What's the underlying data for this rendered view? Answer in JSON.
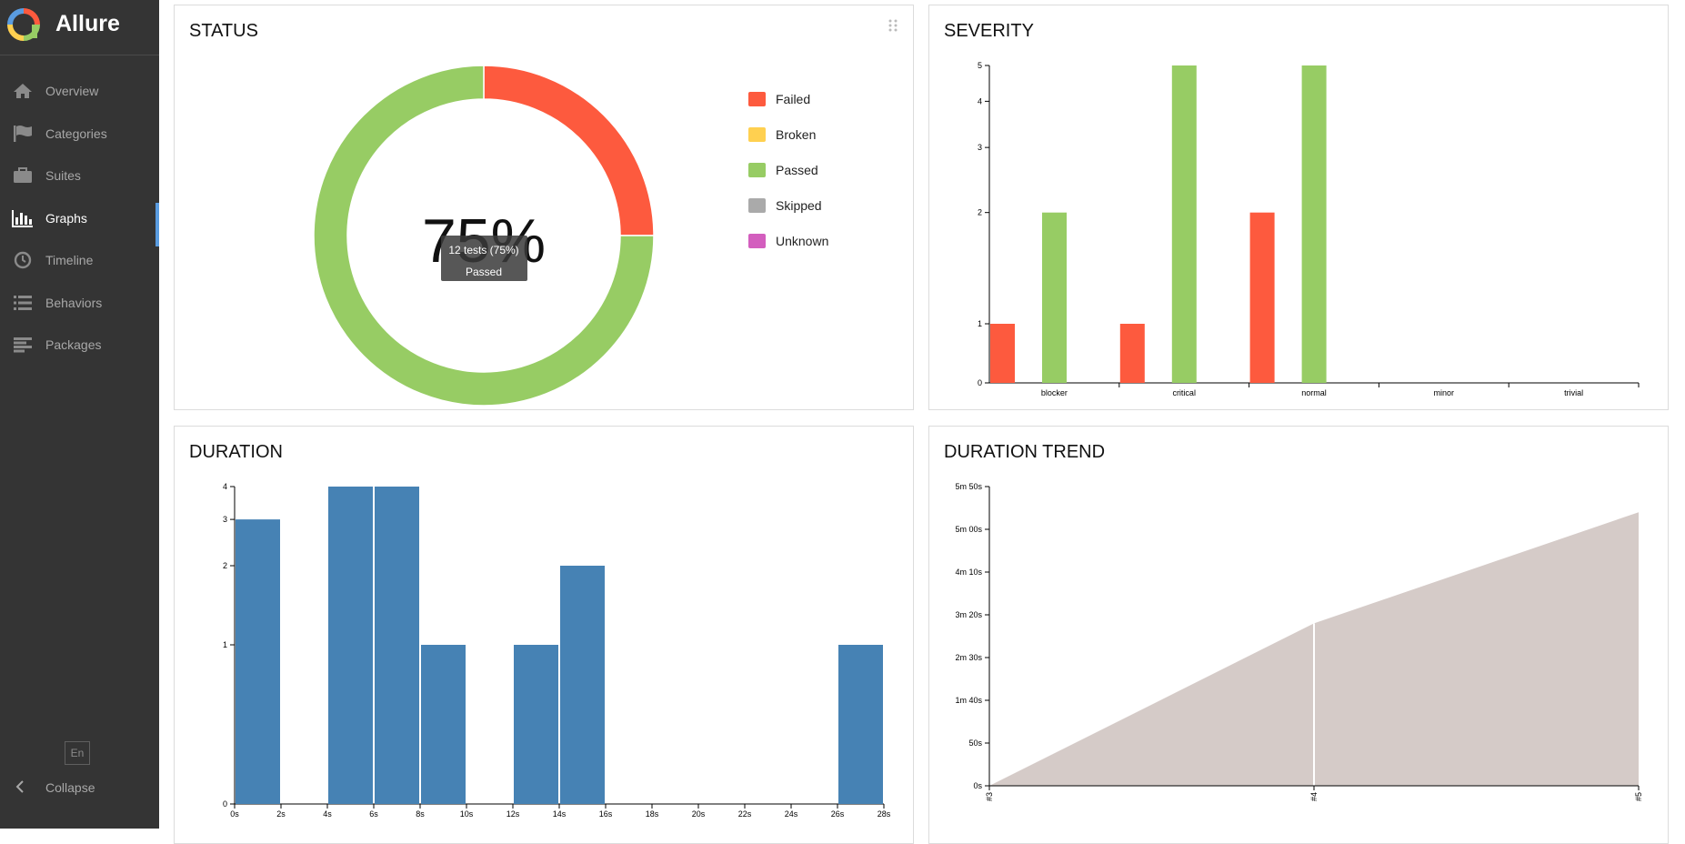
{
  "app": {
    "name": "Allure"
  },
  "sidebar": {
    "items": [
      {
        "id": "overview",
        "label": "Overview",
        "icon": "home-icon"
      },
      {
        "id": "categories",
        "label": "Categories",
        "icon": "flag-icon"
      },
      {
        "id": "suites",
        "label": "Suites",
        "icon": "briefcase-icon"
      },
      {
        "id": "graphs",
        "label": "Graphs",
        "icon": "bar-chart-icon",
        "active": true
      },
      {
        "id": "timeline",
        "label": "Timeline",
        "icon": "clock-icon"
      },
      {
        "id": "behaviors",
        "label": "Behaviors",
        "icon": "list-icon"
      },
      {
        "id": "packages",
        "label": "Packages",
        "icon": "align-left-icon"
      }
    ],
    "language": "En",
    "collapse_label": "Collapse"
  },
  "colors": {
    "failed": "#fd5a3e",
    "broken": "#ffd050",
    "passed": "#97cc64",
    "skipped": "#aaaaaa",
    "unknown": "#d35ebe",
    "duration": "#4682b4",
    "trend": "#d5cbc8",
    "sidebar_bg": "#343434",
    "active_accent": "#5a9ce0"
  },
  "widgets": {
    "status": {
      "title": "STATUS"
    },
    "severity": {
      "title": "SEVERITY"
    },
    "duration": {
      "title": "DURATION"
    },
    "trend": {
      "title": "DURATION TREND"
    }
  },
  "chart_data": [
    {
      "type": "pie",
      "title": "STATUS",
      "center_label": "75%",
      "slices": [
        {
          "name": "Failed",
          "value": 4
        },
        {
          "name": "Broken",
          "value": 0
        },
        {
          "name": "Passed",
          "value": 12
        },
        {
          "name": "Skipped",
          "value": 0
        },
        {
          "name": "Unknown",
          "value": 0
        }
      ],
      "legend": [
        "Failed",
        "Broken",
        "Passed",
        "Skipped",
        "Unknown"
      ],
      "legend_position": "right",
      "tooltip": {
        "line1": "12 tests (75%)",
        "line2": "Passed"
      }
    },
    {
      "type": "bar",
      "title": "SEVERITY",
      "scale": "log",
      "categories": [
        "blocker",
        "critical",
        "normal",
        "minor",
        "trivial"
      ],
      "series": [
        {
          "name": "Failed",
          "values": [
            1,
            1,
            2,
            0,
            0
          ]
        },
        {
          "name": "Passed",
          "values": [
            2,
            5,
            5,
            0,
            0
          ]
        }
      ],
      "yticks": [
        "0",
        "1",
        "2",
        "3",
        "4",
        "5"
      ],
      "ylim": [
        0,
        5
      ]
    },
    {
      "type": "bar",
      "title": "DURATION",
      "scale": "log",
      "bins": [
        {
          "x0": 0,
          "x1": 2,
          "count": 3
        },
        {
          "x0": 2,
          "x1": 4,
          "count": 0
        },
        {
          "x0": 4,
          "x1": 6,
          "count": 4
        },
        {
          "x0": 6,
          "x1": 8,
          "count": 4
        },
        {
          "x0": 8,
          "x1": 10,
          "count": 1
        },
        {
          "x0": 10,
          "x1": 12,
          "count": 0
        },
        {
          "x0": 12,
          "x1": 14,
          "count": 1
        },
        {
          "x0": 14,
          "x1": 16,
          "count": 2
        },
        {
          "x0": 16,
          "x1": 26,
          "count": 0
        },
        {
          "x0": 26,
          "x1": 28,
          "count": 1
        }
      ],
      "xticks": [
        "0s",
        "2s",
        "4s",
        "6s",
        "8s",
        "10s",
        "12s",
        "14s",
        "16s",
        "18s",
        "20s",
        "22s",
        "24s",
        "26s",
        "28s"
      ],
      "yticks": [
        "0",
        "1",
        "2",
        "3",
        "4"
      ],
      "xlim": [
        0,
        28
      ],
      "ylim": [
        0,
        4
      ]
    },
    {
      "type": "area",
      "title": "DURATION TREND",
      "x": [
        "#3",
        "#4",
        "#5"
      ],
      "values": [
        0,
        190,
        320
      ],
      "yticks": [
        {
          "label": "0s",
          "value": 0
        },
        {
          "label": "50s",
          "value": 50
        },
        {
          "label": "1m 40s",
          "value": 100
        },
        {
          "label": "2m 30s",
          "value": 150
        },
        {
          "label": "3m 20s",
          "value": 200
        },
        {
          "label": "4m 10s",
          "value": 250
        },
        {
          "label": "5m 00s",
          "value": 300
        },
        {
          "label": "5m 50s",
          "value": 350
        }
      ],
      "ylim": [
        0,
        350
      ]
    }
  ]
}
